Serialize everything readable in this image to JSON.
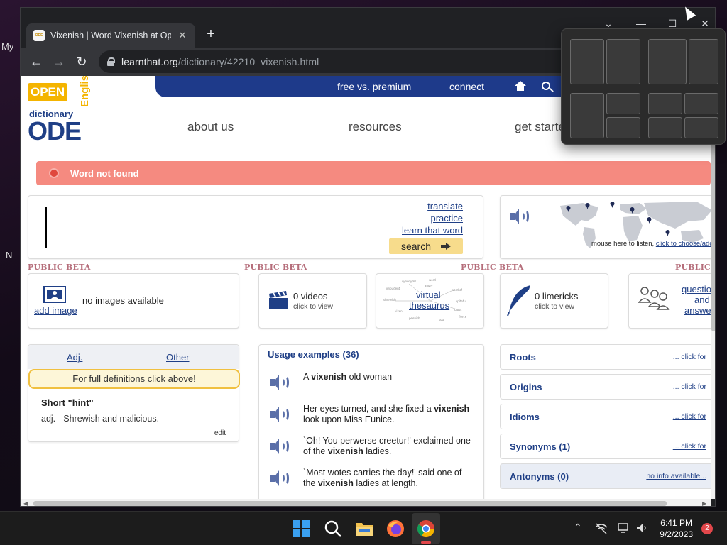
{
  "desktop": {
    "fragment_top": "My",
    "fragment_mid": "N"
  },
  "browser": {
    "tab": {
      "title": "Vixenish | Word Vixenish at OpenEnglish",
      "favicon": "ODE"
    },
    "url": {
      "host": "learnthat.org",
      "path": "/dictionary/42210_vixenish.html"
    },
    "window_controls": {
      "dropdown": "⌄",
      "minimize": "—",
      "maximize": "☐",
      "close": "✕"
    }
  },
  "site": {
    "logo": {
      "open": "OPEN",
      "dictionary": "dictionary",
      "ode": "ODE",
      "english": "English"
    },
    "topbar": {
      "free_vs_premium": "free vs. premium",
      "connect": "connect"
    },
    "mainnav": {
      "about": "about us",
      "resources": "resources",
      "get_started": "get started"
    },
    "alert": {
      "text": "Word not found"
    },
    "search": {
      "links": [
        "translate",
        "practice",
        "learn that word"
      ],
      "button": "search"
    },
    "audio": {
      "caption_text": "mouse here to listen, ",
      "caption_link": "click to choose/add"
    },
    "beta_label": "PUBLIC BETA",
    "cards": {
      "images": {
        "link": "add image",
        "text": "no images available"
      },
      "videos": {
        "count": "0 videos",
        "sub": "click to view"
      },
      "thesaurus": {
        "line1": "virtual",
        "line2": "thesaurus"
      },
      "limericks": {
        "count": "0 limericks",
        "sub": "click to view"
      },
      "qa": {
        "line1": "questions",
        "line2": "and",
        "line3": "answers"
      }
    },
    "definitions": {
      "tab_adj": "Adj.",
      "tab_other": "Other",
      "notice": "For full definitions click above!",
      "hint_title": "Short \"hint\"",
      "hint_text": "adj. - Shrewish and malicious.",
      "edit": "edit"
    },
    "usage": {
      "heading": "Usage examples (36)",
      "items": [
        {
          "before": "A ",
          "word": "vixenish",
          "after": " old woman"
        },
        {
          "before": "Her eyes turned, and she fixed a ",
          "word": "vixenish",
          "after": " look upon Miss Eunice."
        },
        {
          "before": "`Oh! You perwerse creetur!' exclaimed one of the ",
          "word": "vixenish",
          "after": " ladies."
        },
        {
          "before": "`Most wotes carries the day!' said one of the ",
          "word": "vixenish",
          "after": " ladies at length."
        }
      ]
    },
    "side": [
      {
        "label": "Roots",
        "link": "... click for"
      },
      {
        "label": "Origins",
        "link": "... click for"
      },
      {
        "label": "Idioms",
        "link": "... click for"
      },
      {
        "label": "Synonyms (1)",
        "link": "... click for"
      },
      {
        "label": "Antonyms (0)",
        "link": "no info available..."
      }
    ]
  },
  "taskbar": {
    "time": "6:41 PM",
    "date": "9/2/2023",
    "notifications": "2",
    "apps": [
      "start-icon",
      "search-icon",
      "file-explorer-icon",
      "firefox-icon",
      "chrome-icon"
    ]
  },
  "colors": {
    "accent_blue": "#1e3a8a",
    "alert_red": "#f58a80",
    "logo_yellow": "#f4b400"
  }
}
